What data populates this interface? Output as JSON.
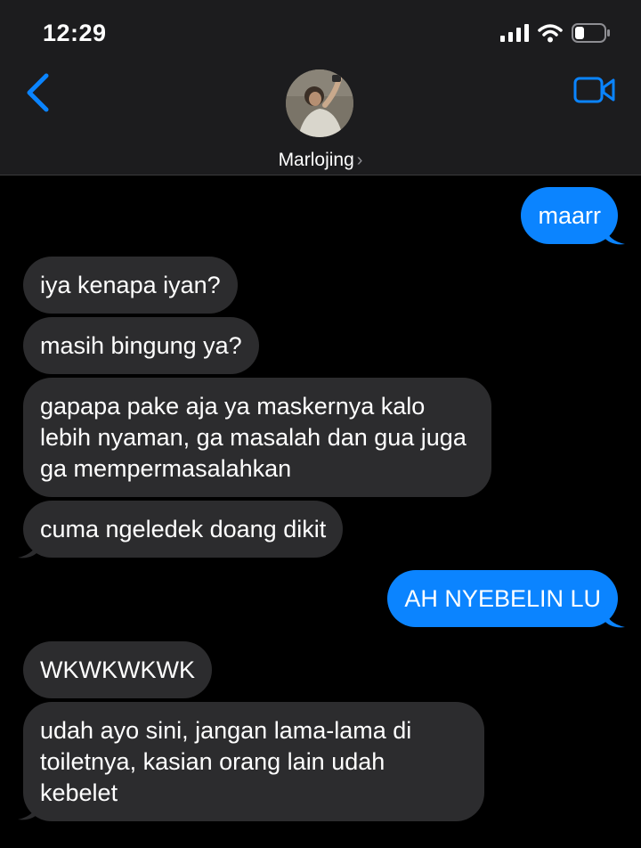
{
  "status_bar": {
    "time": "12:29"
  },
  "header": {
    "contact_name": "Marlojing"
  },
  "messages": [
    {
      "from": "me",
      "text": "maarr"
    },
    {
      "from": "them",
      "text": "iya kenapa iyan?"
    },
    {
      "from": "them",
      "text": "masih bingung ya?"
    },
    {
      "from": "them",
      "text": "gapapa pake aja ya maskernya kalo lebih nyaman, ga masalah dan gua juga ga mempermasalahkan"
    },
    {
      "from": "them",
      "text": "cuma ngeledek doang dikit"
    },
    {
      "from": "me",
      "text": "AH NYEBELIN LU"
    },
    {
      "from": "them",
      "text": "WKWKWKWK"
    },
    {
      "from": "them",
      "text": "udah ayo sini, jangan lama-lama di toiletnya, kasian orang lain udah kebelet"
    }
  ],
  "colors": {
    "outgoing": "#0b84ff",
    "incoming": "#2c2c2e",
    "header_bg": "#1c1c1e",
    "accent": "#0a84ff"
  },
  "icons": [
    "signal-icon",
    "wifi-icon",
    "battery-icon",
    "back-chevron-icon",
    "video-call-icon"
  ]
}
